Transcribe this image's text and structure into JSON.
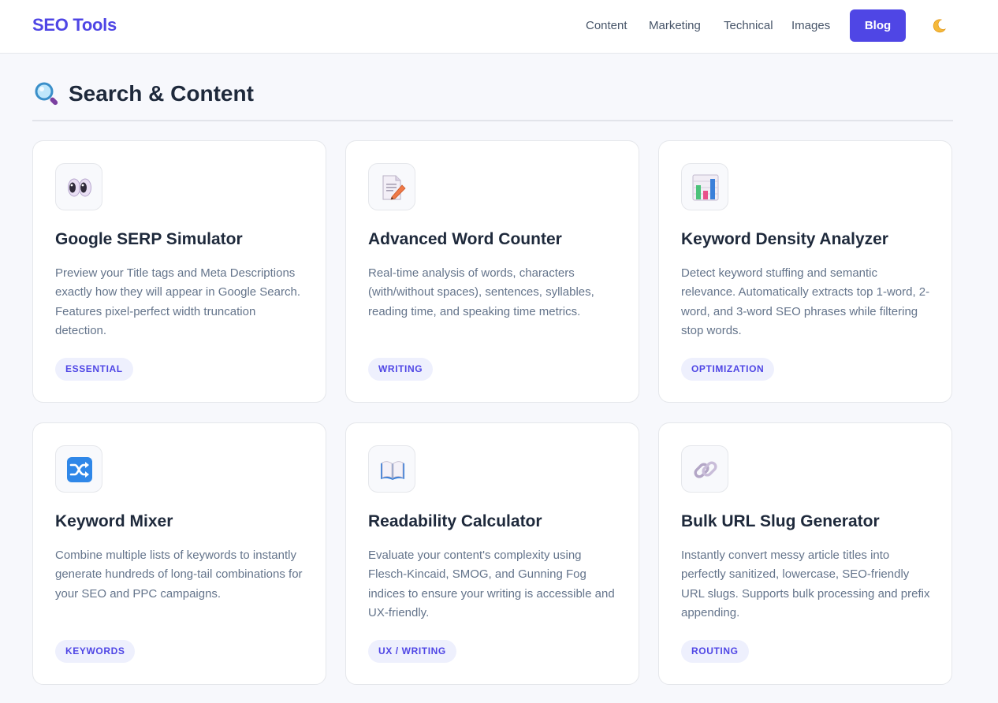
{
  "header": {
    "brand": "SEO Tools",
    "nav": [
      {
        "label": "Content",
        "name": "nav-content"
      },
      {
        "label": "Marketing",
        "name": "nav-marketing"
      },
      {
        "label": "Technical",
        "name": "nav-technical"
      },
      {
        "label": "Images",
        "name": "nav-images"
      }
    ],
    "blog_label": "Blog",
    "theme_toggle_icon": "moon-icon"
  },
  "section": {
    "icon": "magnifying-glass-icon",
    "title": "Search & Content"
  },
  "cards": [
    {
      "icon": "eyes-icon",
      "title": "Google SERP Simulator",
      "desc": "Preview your Title tags and Meta Descriptions exactly how they will appear in Google Search. Features pixel-perfect width truncation detection.",
      "tag": "ESSENTIAL"
    },
    {
      "icon": "memo-icon",
      "title": "Advanced Word Counter",
      "desc": "Real-time analysis of words, characters (with/without spaces), sentences, syllables, reading time, and speaking time metrics.",
      "tag": "WRITING"
    },
    {
      "icon": "bar-chart-icon",
      "title": "Keyword Density Analyzer",
      "desc": "Detect keyword stuffing and semantic relevance. Automatically extracts top 1-word, 2-word, and 3-word SEO phrases while filtering stop words.",
      "tag": "OPTIMIZATION"
    },
    {
      "icon": "shuffle-icon",
      "title": "Keyword Mixer",
      "desc": "Combine multiple lists of keywords to instantly generate hundreds of long-tail combinations for your SEO and PPC campaigns.",
      "tag": "KEYWORDS"
    },
    {
      "icon": "open-book-icon",
      "title": "Readability Calculator",
      "desc": "Evaluate your content's complexity using Flesch-Kincaid, SMOG, and Gunning Fog indices to ensure your writing is accessible and UX-friendly.",
      "tag": "UX / WRITING"
    },
    {
      "icon": "link-icon",
      "title": "Bulk URL Slug Generator",
      "desc": "Instantly convert messy article titles into perfectly sanitized, lowercase, SEO-friendly URL slugs. Supports bulk processing and prefix appending.",
      "tag": "ROUTING"
    }
  ],
  "colors": {
    "accent": "#4f46e5",
    "background": "#f7f8fc",
    "tag_background": "#eef0fd",
    "text_primary": "#1e293b",
    "text_muted": "#64748b"
  }
}
